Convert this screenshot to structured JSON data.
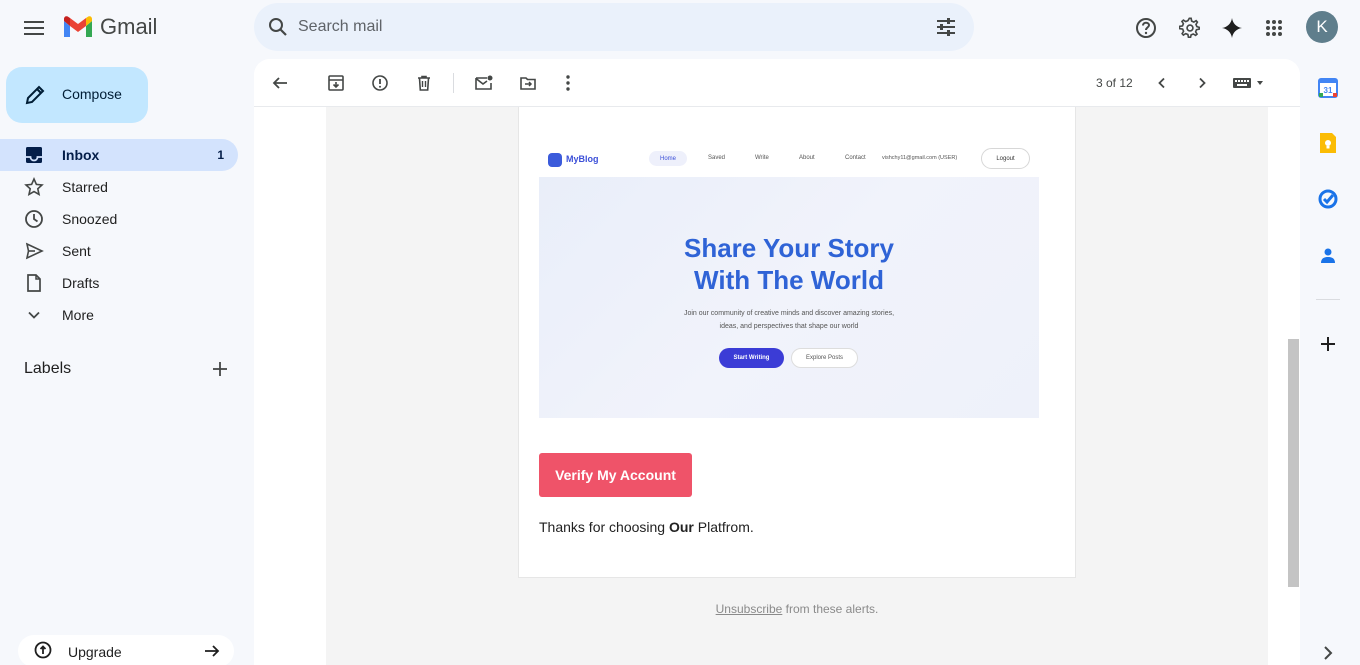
{
  "app": {
    "name": "Gmail"
  },
  "search": {
    "placeholder": "Search mail"
  },
  "account": {
    "initial": "K"
  },
  "compose": {
    "label": "Compose"
  },
  "sidebar": {
    "items": [
      {
        "label": "Inbox",
        "count": "1",
        "active": true
      },
      {
        "label": "Starred"
      },
      {
        "label": "Snoozed"
      },
      {
        "label": "Sent"
      },
      {
        "label": "Drafts"
      },
      {
        "label": "More"
      }
    ],
    "labels_header": "Labels",
    "upgrade_label": "Upgrade"
  },
  "toolbar": {
    "pager": "3 of 12"
  },
  "email": {
    "preview": {
      "brand": "MyBlog",
      "nav": [
        "Home",
        "Saved",
        "Write",
        "About",
        "Contact"
      ],
      "user": "vishchy11@gmail.com (USER)",
      "logout": "Logout",
      "headline_1": "Share Your Story",
      "headline_2": "With The World",
      "sub_1": "Join our community of creative minds and discover amazing stories,",
      "sub_2": "ideas, and perspectives that shape our world",
      "btn_primary": "Start Writing",
      "btn_secondary": "Explore Posts"
    },
    "verify_button": "Verify My Account",
    "thanks_prefix": "Thanks for choosing ",
    "thanks_bold": "Our",
    "thanks_suffix": " Platfrom.",
    "unsubscribe_link": "Unsubscribe",
    "unsubscribe_rest": " from these alerts."
  },
  "colors": {
    "accent": "#c2e7ff",
    "active_nav": "#d3e3fd",
    "verify_button": "#ef5369",
    "hero_title": "#2f63d6"
  }
}
